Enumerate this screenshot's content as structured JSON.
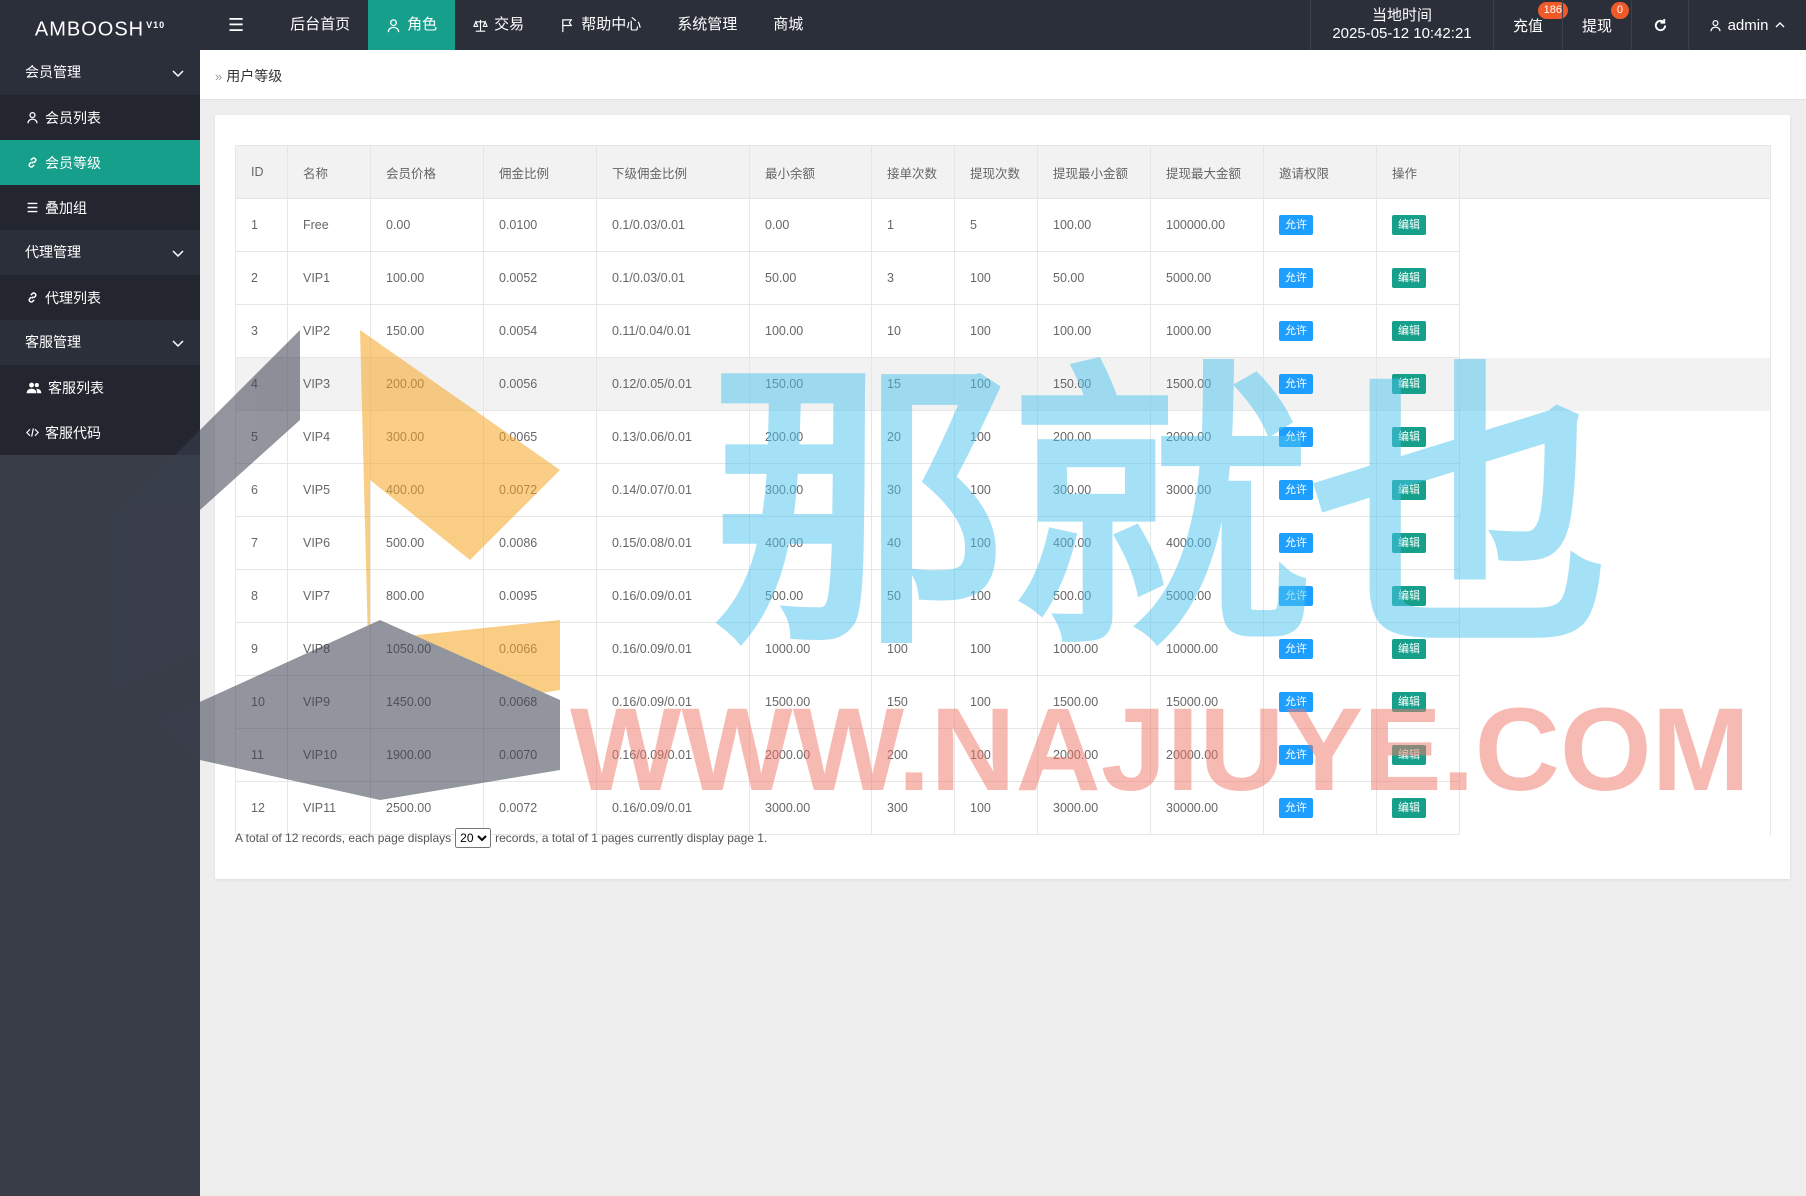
{
  "app": {
    "logo": "AMBOOSH",
    "logo_version": "V10"
  },
  "topnav": [
    {
      "label": "后台首页",
      "icon": "none"
    },
    {
      "label": "角色",
      "icon": "user-icon"
    },
    {
      "label": "交易",
      "icon": "scale-icon"
    },
    {
      "label": "帮助中心",
      "icon": "flag-icon"
    },
    {
      "label": "系统管理",
      "icon": "none"
    },
    {
      "label": "商城",
      "icon": "none"
    }
  ],
  "topright": {
    "time_label": "当地时间",
    "time_value": "2025-05-12 10:42:21",
    "recharge_label": "充值",
    "recharge_badge": "186",
    "withdraw_label": "提现",
    "withdraw_badge": "0",
    "user_label": "admin"
  },
  "sidebar": {
    "group1": "会员管理",
    "member_list": "会员列表",
    "member_level": "会员等级",
    "stack_group": "叠加组",
    "group2": "代理管理",
    "agent_list": "代理列表",
    "group3": "客服管理",
    "cs_list": "客服列表",
    "cs_code": "客服代码"
  },
  "breadcrumb": "用户等级",
  "table": {
    "headers": [
      "ID",
      "名称",
      "会员价格",
      "佣金比例",
      "下级佣金比例",
      "最小余额",
      "接单次数",
      "提现次数",
      "提现最小金额",
      "提现最大金额",
      "邀请权限",
      "操作"
    ],
    "allow_label": "允许",
    "edit_label": "编辑",
    "rows": [
      [
        "1",
        "Free",
        "0.00",
        "0.0100",
        "0.1/0.03/0.01",
        "0.00",
        "1",
        "5",
        "100.00",
        "100000.00"
      ],
      [
        "2",
        "VIP1",
        "100.00",
        "0.0052",
        "0.1/0.03/0.01",
        "50.00",
        "3",
        "100",
        "50.00",
        "5000.00"
      ],
      [
        "3",
        "VIP2",
        "150.00",
        "0.0054",
        "0.11/0.04/0.01",
        "100.00",
        "10",
        "100",
        "100.00",
        "1000.00"
      ],
      [
        "4",
        "VIP3",
        "200.00",
        "0.0056",
        "0.12/0.05/0.01",
        "150.00",
        "15",
        "100",
        "150.00",
        "1500.00"
      ],
      [
        "5",
        "VIP4",
        "300.00",
        "0.0065",
        "0.13/0.06/0.01",
        "200.00",
        "20",
        "100",
        "200.00",
        "2000.00"
      ],
      [
        "6",
        "VIP5",
        "400.00",
        "0.0072",
        "0.14/0.07/0.01",
        "300.00",
        "30",
        "100",
        "300.00",
        "3000.00"
      ],
      [
        "7",
        "VIP6",
        "500.00",
        "0.0086",
        "0.15/0.08/0.01",
        "400.00",
        "40",
        "100",
        "400.00",
        "4000.00"
      ],
      [
        "8",
        "VIP7",
        "800.00",
        "0.0095",
        "0.16/0.09/0.01",
        "500.00",
        "50",
        "100",
        "500.00",
        "5000.00"
      ],
      [
        "9",
        "VIP8",
        "1050.00",
        "0.0066",
        "0.16/0.09/0.01",
        "1000.00",
        "100",
        "100",
        "1000.00",
        "10000.00"
      ],
      [
        "10",
        "VIP9",
        "1450.00",
        "0.0068",
        "0.16/0.09/0.01",
        "1500.00",
        "150",
        "100",
        "1500.00",
        "15000.00"
      ],
      [
        "11",
        "VIP10",
        "1900.00",
        "0.0070",
        "0.16/0.09/0.01",
        "2000.00",
        "200",
        "100",
        "2000.00",
        "20000.00"
      ],
      [
        "12",
        "VIP11",
        "2500.00",
        "0.0072",
        "0.16/0.09/0.01",
        "3000.00",
        "300",
        "100",
        "3000.00",
        "30000.00"
      ]
    ]
  },
  "pager": {
    "text_before": "A total of 12 records, each page displays",
    "page_size": "20",
    "text_after": "records, a total of 1 pages currently display page 1."
  },
  "watermark": {
    "cn_text": "那就也",
    "url_text": "WWW.NAJIUYE.COM"
  },
  "colors": {
    "accent": "#16a08b",
    "topbar": "#2b2f3a",
    "sidebar": "#393d48",
    "allow_button": "#1e9fff",
    "badge": "#f05a29"
  }
}
